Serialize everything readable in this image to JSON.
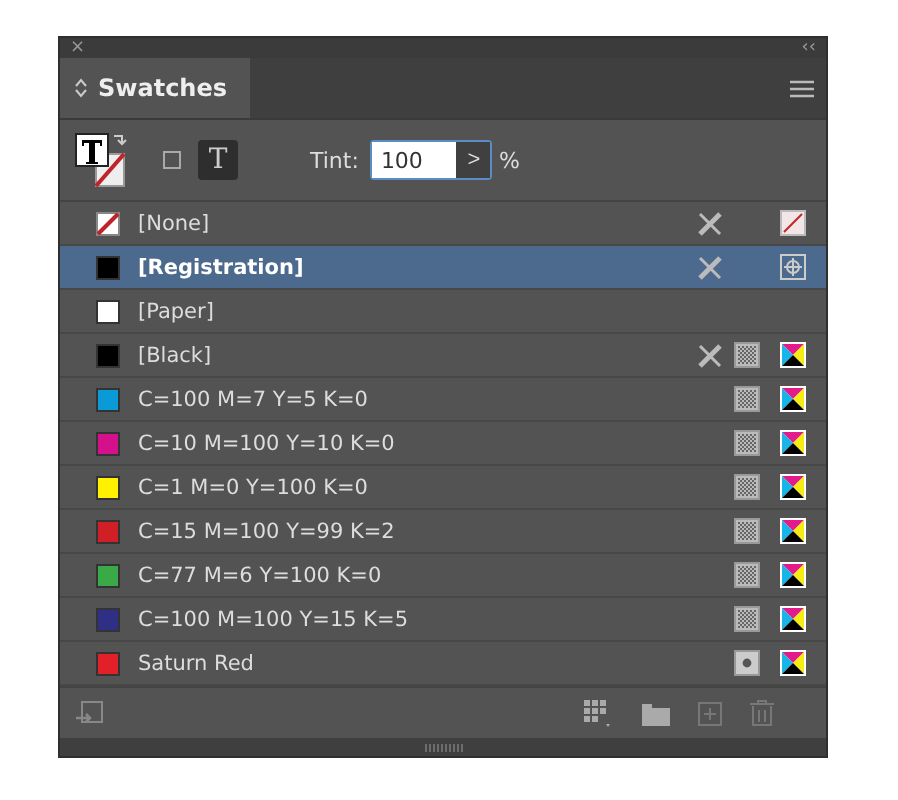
{
  "panel": {
    "close": "×",
    "collapse": "‹‹"
  },
  "tabs": [
    {
      "label": "Swatches",
      "selected": true
    }
  ],
  "controls": {
    "text_mode": "T",
    "tint_label": "Tint:",
    "tint_value": "100",
    "stepper": ">",
    "percent": "%"
  },
  "swatches": [
    {
      "name": "[None]",
      "kind": "none",
      "color": "#ffffff",
      "selected": false,
      "locked": true
    },
    {
      "name": "[Registration]",
      "kind": "registration",
      "color": "#000000",
      "selected": true,
      "locked": true
    },
    {
      "name": "[Paper]",
      "kind": "plain",
      "color": "#ffffff",
      "selected": false,
      "locked": false
    },
    {
      "name": "[Black]",
      "kind": "process",
      "color": "#000000",
      "selected": false,
      "locked": true
    },
    {
      "name": "C=100 M=7 Y=5 K=0",
      "kind": "process",
      "color": "#0b9ad8",
      "selected": false,
      "locked": false
    },
    {
      "name": "C=10 M=100 Y=10 K=0",
      "kind": "process",
      "color": "#d4108a",
      "selected": false,
      "locked": false
    },
    {
      "name": "C=1 M=0 Y=100 K=0",
      "kind": "process",
      "color": "#fff100",
      "selected": false,
      "locked": false
    },
    {
      "name": "C=15 M=100 Y=99 K=2",
      "kind": "process",
      "color": "#d01f26",
      "selected": false,
      "locked": false
    },
    {
      "name": "C=77 M=6 Y=100 K=0",
      "kind": "process",
      "color": "#3aaa48",
      "selected": false,
      "locked": false
    },
    {
      "name": "C=100 M=100 Y=15 K=5",
      "kind": "process",
      "color": "#2f2f86",
      "selected": false,
      "locked": false
    },
    {
      "name": "Saturn Red",
      "kind": "spot",
      "color": "#e2202a",
      "selected": false,
      "locked": false
    }
  ]
}
